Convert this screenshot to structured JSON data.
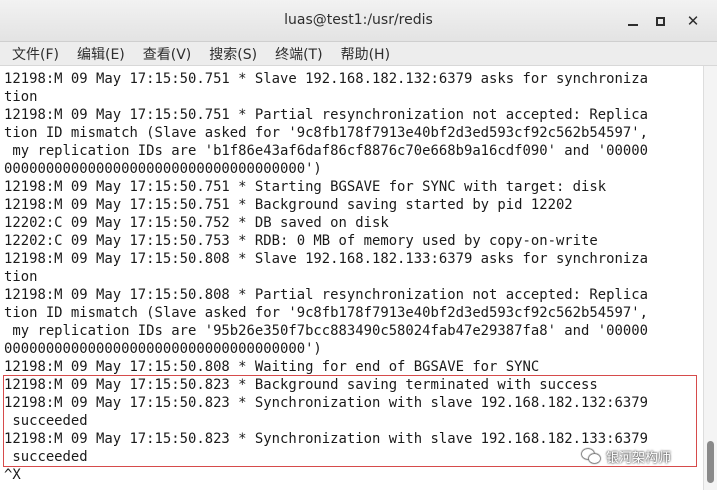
{
  "window": {
    "title": "luas@test1:/usr/redis",
    "minimize_glyph": "",
    "close_glyph": "✕"
  },
  "menu": [
    {
      "label": "文件(F)"
    },
    {
      "label": "编辑(E)"
    },
    {
      "label": "查看(V)"
    },
    {
      "label": "搜索(S)"
    },
    {
      "label": "终端(T)"
    },
    {
      "label": "帮助(H)"
    }
  ],
  "terminal": {
    "lines": [
      "12198:M 09 May 17:15:50.751 * Slave 192.168.182.132:6379 asks for synchroniza",
      "tion",
      "12198:M 09 May 17:15:50.751 * Partial resynchronization not accepted: Replica",
      "tion ID mismatch (Slave asked for '9c8fb178f7913e40bf2d3ed593cf92c562b54597',",
      " my replication IDs are 'b1f86e43af6daf86cf8876c70e668b9a16cdf090' and '00000",
      "000000000000000000000000000000000000')",
      "12198:M 09 May 17:15:50.751 * Starting BGSAVE for SYNC with target: disk",
      "12198:M 09 May 17:15:50.751 * Background saving started by pid 12202",
      "12202:C 09 May 17:15:50.752 * DB saved on disk",
      "12202:C 09 May 17:15:50.753 * RDB: 0 MB of memory used by copy-on-write",
      "12198:M 09 May 17:15:50.808 * Slave 192.168.182.133:6379 asks for synchroniza",
      "tion",
      "12198:M 09 May 17:15:50.808 * Partial resynchronization not accepted: Replica",
      "tion ID mismatch (Slave asked for '9c8fb178f7913e40bf2d3ed593cf92c562b54597',",
      " my replication IDs are '95b26e350f7bcc883490c58024fab47e29387fa8' and '00000",
      "000000000000000000000000000000000000')",
      "12198:M 09 May 17:15:50.808 * Waiting for end of BGSAVE for SYNC",
      "12198:M 09 May 17:15:50.823 * Background saving terminated with success",
      "12198:M 09 May 17:15:50.823 * Synchronization with slave 192.168.182.132:6379",
      " succeeded",
      "12198:M 09 May 17:15:50.823 * Synchronization with slave 192.168.182.133:6379",
      " succeeded",
      "^X"
    ]
  },
  "watermark": {
    "text": "银河架构师"
  },
  "colors": {
    "highlight_border": "#d64b4b",
    "terminal_bg": "#ffffff",
    "terminal_fg": "#1a1a1a"
  }
}
